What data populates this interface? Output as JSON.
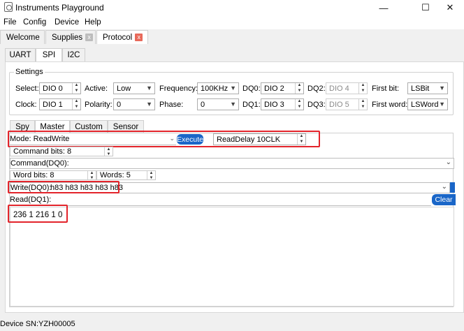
{
  "window": {
    "title": "Instruments Playground",
    "minimize_glyph": "—",
    "maximize_glyph": "☐",
    "close_glyph": "✕"
  },
  "menu": [
    "File",
    "Config",
    "Device",
    "Help"
  ],
  "doc_tabs": [
    {
      "label": "Welcome"
    },
    {
      "label": "Supplies",
      "close": "x"
    },
    {
      "label": "Protocol",
      "close": "x"
    }
  ],
  "protocol_tabs": [
    "UART",
    "SPI",
    "I2C"
  ],
  "settings": {
    "legend": "Settings",
    "select_label": "Select:",
    "select_value": "DIO 0",
    "clock_label": "Clock:",
    "clock_value": "DIO 1",
    "active_label": "Active:",
    "active_value": "Low",
    "polarity_label": "Polarity:",
    "polarity_value": "0",
    "frequency_label": "Frequency:",
    "frequency_value": "100KHz",
    "phase_label": "Phase:",
    "phase_value": "0",
    "dq0_label": "DQ0:",
    "dq0_value": "DIO 2",
    "dq1_label": "DQ1:",
    "dq1_value": "DIO 3",
    "dq2_label": "DQ2:",
    "dq2_value": "DIO 4",
    "dq3_label": "DQ3:",
    "dq3_value": "DIO 5",
    "firstbit_label": "First bit:",
    "firstbit_value": "LSBit",
    "firstword_label": "First word:",
    "firstword_value": "LSWord"
  },
  "mode_tabs": [
    "Spy",
    "Master",
    "Custom",
    "Sensor"
  ],
  "master": {
    "mode_label": "Mode: ReadWrite",
    "execute_label": "Execute",
    "readdelay_label": "ReadDelay 10CLK",
    "command_bits_label": "Command bits: 8",
    "command_dq0_label": "Command(DQ0):",
    "word_bits_label": "Word bits: 8",
    "words_label": "Words: 5",
    "write_label": "Write(DQ0):",
    "write_value": "h83 h83 h83 h83 h83",
    "read_label": "Read(DQ1):",
    "clear_label": "Clear",
    "read_value": "236 1 216 1 0"
  },
  "status": {
    "device_sn": "Device SN:YZH00005"
  },
  "colors": {
    "accent": "#1a66c8",
    "highlight": "#e3242b",
    "tab_close": "#e8695a"
  }
}
